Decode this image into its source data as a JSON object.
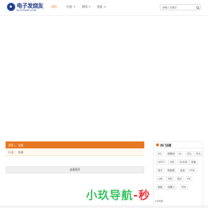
{
  "header": {
    "logo_title": "电子发烧友",
    "logo_sub": "ELECFANS.COM",
    "nav": [
      {
        "label": "首页",
        "active": true
      },
      {
        "label": "行业",
        "has_dropdown": true
      },
      {
        "label": "资讯",
        "has_dropdown": true
      },
      {
        "label": "社区",
        "has_dropdown": true
      }
    ],
    "search_placeholder": "请输入关键字"
  },
  "breadcrumb": {
    "section": "资讯",
    "separator": "|",
    "current": "全部"
  },
  "sub_tabs": {
    "items": [
      "行业",
      "|",
      "电源"
    ]
  },
  "load_more": "加载更多",
  "hot_tags": {
    "title": "热门话题",
    "tags": [
      "5G",
      "物联网",
      "AI",
      "芯片",
      "华为",
      "OPPO",
      "汽车",
      "5G手机",
      "苹果",
      "电子",
      "新能源",
      "电池",
      "PCB",
      "小米",
      "手机",
      "显示",
      "VR",
      "面板",
      "机器人",
      "华为"
    ]
  },
  "watermark": {
    "part1": "小玖导航",
    "part2": "-秒",
    "badge": "小玖导航"
  },
  "colors": {
    "accent": "#e87722",
    "brand": "#1e3a8a",
    "watermark_green": "#33c45c",
    "watermark_red": "#e8343a"
  }
}
